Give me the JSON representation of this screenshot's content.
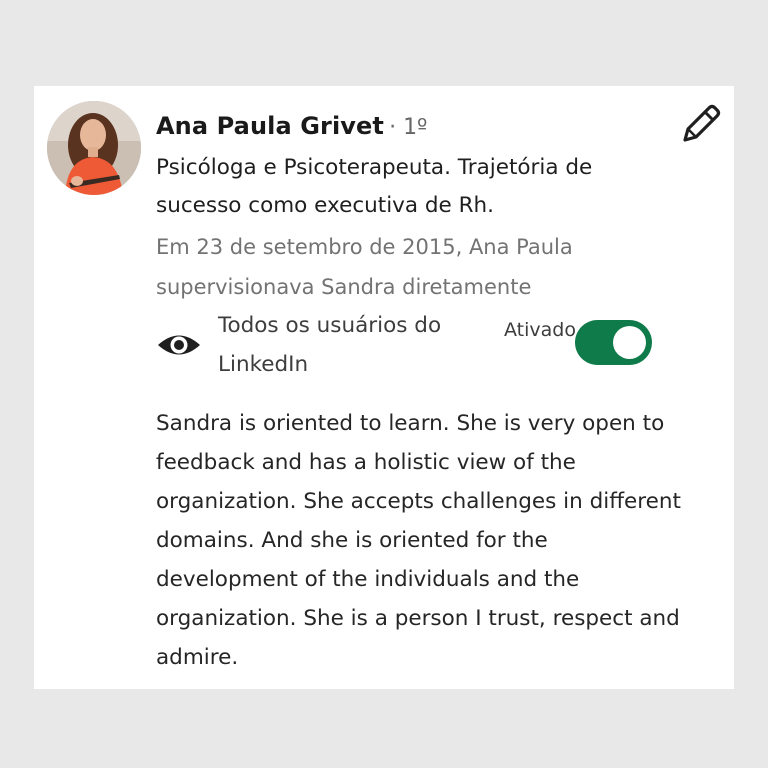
{
  "recommender": {
    "name": "Ana Paula Grivet",
    "degree": "· 1º",
    "headline": "Psicóloga e Psicoterapeuta. Trajetória de sucesso como executiva de Rh.",
    "relationship": "Em 23 de setembro de 2015, Ana Paula supervisionava Sandra diretamente"
  },
  "visibility": {
    "icon": "eye-icon",
    "label": "Todos os usuários do LinkedIn",
    "toggle_label": "Ativado",
    "toggle_on": true
  },
  "actions": {
    "edit_icon": "pencil-icon"
  },
  "recommendation": {
    "text": "Sandra is oriented to learn. She is very open to feedback and has a holistic view of the organization. She accepts challenges in different domains. And she is oriented for the development of the individuals and the organization. She is a person I trust, respect and admire."
  },
  "colors": {
    "background": "#e8e8e8",
    "card": "#ffffff",
    "toggle_on": "#0f7b4a",
    "secondary_text": "#737373"
  }
}
